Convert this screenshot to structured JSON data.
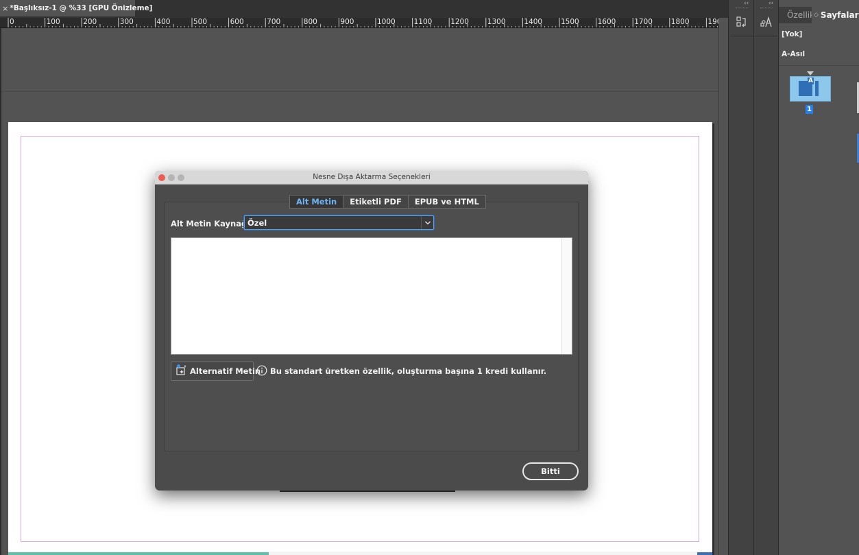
{
  "document_tab": {
    "close_glyph": "×",
    "title": "*Başlıksız-1 @ %33 [GPU Önizleme]"
  },
  "ruler": {
    "labels": [
      "0",
      "100",
      "200",
      "300",
      "400",
      "500",
      "600",
      "700",
      "800",
      "900",
      "1000",
      "1100",
      "1200",
      "1300",
      "1400",
      "1500",
      "1600",
      "1700",
      "1800",
      "190"
    ]
  },
  "docks": {
    "collapse_glyph": "‹‹",
    "dock1_icon": "history-icon",
    "dock2_icon": "character-styles-icon"
  },
  "panel": {
    "tab_inactive": "Özellikl",
    "tab_active_glyph": "◇",
    "tab_active": "Sayfalar",
    "none_label": "[Yok]",
    "master_label": "A-Asıl",
    "thumb_letter": "A",
    "page_number": "1"
  },
  "dialog": {
    "title": "Nesne Dışa Aktarma Seçenekleri",
    "tabs": [
      {
        "label": "Alt Metin",
        "active": true
      },
      {
        "label": "Etiketli PDF",
        "active": false
      },
      {
        "label": "EPUB ve HTML",
        "active": false
      }
    ],
    "source_label": "Alt Metin Kaynağı:",
    "source_value": "Özel",
    "alt_text_value": "",
    "alt_button_label": "Alternatif Metin",
    "info_text": "Bu standart üretken özellik, oluşturma başına 1 kredi kullanır.",
    "done_label": "Bitti"
  },
  "colors": {
    "accent": "#2680eb",
    "active_tab_text": "#6fb3f5",
    "margin_guide": "#d9a3e6",
    "traffic_close": "#ee5b53",
    "traffic_inactive": "#b5b5b5"
  }
}
